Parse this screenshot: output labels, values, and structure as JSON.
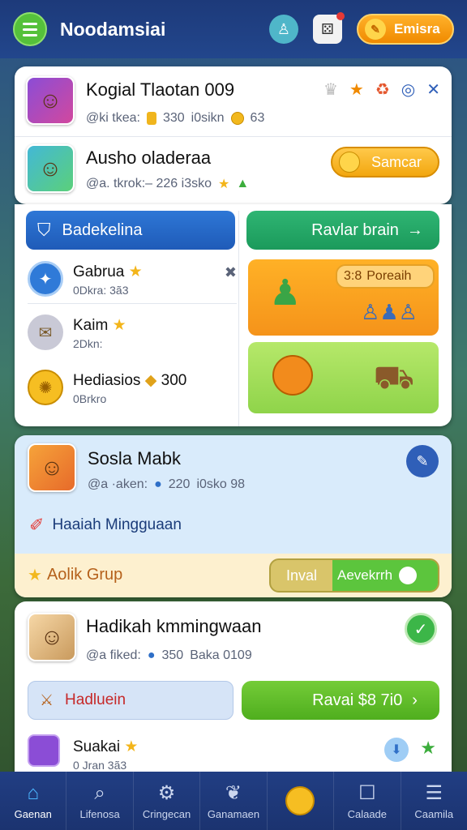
{
  "app": {
    "title": "Noodamsiai",
    "pill_label": "Emisra"
  },
  "profile_card": {
    "name": "Kogial Tlaotan 009",
    "stats_handle": "@ki tkea:",
    "stats_value1": "330",
    "stats_text2": "i0sikn",
    "stats_value2": "63"
  },
  "profile_card2": {
    "name": "Ausho oladeraa",
    "stats": "@a. tkrok:– 226  i3sko",
    "button": "Samcar"
  },
  "left_panel": {
    "header": "Badekelina",
    "items": [
      {
        "name": "Gabrua",
        "sub": "0Dkra: 3ã3"
      },
      {
        "name": "Kaim",
        "sub": "2Dkn:"
      },
      {
        "name": "Hediasios",
        "value": "300",
        "sub": "0Brkro"
      }
    ]
  },
  "right_panel": {
    "button": "Ravlar brain",
    "tile_pill": "Poreaih",
    "tile_pill_prefix": "3:8"
  },
  "social_card": {
    "name": "Sosla Mabk",
    "stats": "@a ·aken:",
    "stats_value1": "220",
    "stats_text2": "i0sko 98",
    "quest": "Haaiah Mingguaan",
    "footer_label": "Aolik Grup",
    "footer_btn1": "Inval",
    "footer_btn2": "Aevekrrh"
  },
  "reward_card": {
    "name": "Hadikah kmmingwaan",
    "stats": "@a fiked:",
    "stats_value1": "350",
    "stats_text2": "Baka 0109",
    "left_btn": "Hadluein",
    "right_btn": "Ravai $8 7i0",
    "item_name": "Suakai",
    "item_sub": "0 Jran 3ã3"
  },
  "nav": [
    {
      "label": "Gaenan",
      "icon": "home-icon"
    },
    {
      "label": "Lifenosa",
      "icon": "search-icon"
    },
    {
      "label": "Cringecan",
      "icon": "gear-icon"
    },
    {
      "label": "Ganamaen",
      "icon": "leaf-icon"
    },
    {
      "label": "",
      "icon": "coin-icon"
    },
    {
      "label": "Calaade",
      "icon": "chat-icon"
    },
    {
      "label": "Caamila",
      "icon": "menu-icon"
    }
  ]
}
